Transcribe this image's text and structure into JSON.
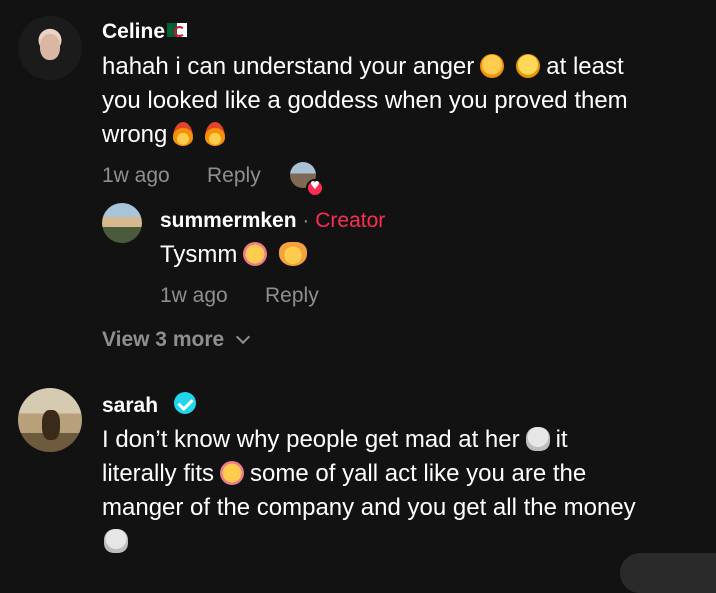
{
  "comments": [
    {
      "username": "Celine",
      "text_parts": [
        "hahah i can understand your anger",
        "at least",
        "you looked like a goddess when you proved them",
        "wrong"
      ],
      "time": "1w ago",
      "reply_label": "Reply",
      "icons": [
        "algeria-flag-icon",
        "crying-face-emoji",
        "laughing-face-emoji",
        "fire-emoji",
        "fire-emoji"
      ],
      "reply": {
        "username": "summermken",
        "badge": "Creator",
        "text": "Tysmm",
        "time": "1w ago",
        "reply_label": "Reply",
        "icons": [
          "smiling-hearts-emoji",
          "heart-hands-emoji"
        ]
      },
      "view_more": "View 3 more"
    },
    {
      "username": "sarah",
      "verified": true,
      "text_parts": [
        "I don’t know why people get mad at her",
        "it",
        "literally fits",
        "some of yall act like you are the",
        "manger of the company and you get all the money"
      ],
      "icons": [
        "verified-icon",
        "skull-emoji",
        "smiling-hearts-emoji",
        "skull-emoji"
      ]
    }
  ],
  "colors": {
    "background": "#121212",
    "text": "#ffffff",
    "meta": "#8f8f8f",
    "creator_badge": "#fe2c55",
    "verified": "#20d5ec"
  }
}
